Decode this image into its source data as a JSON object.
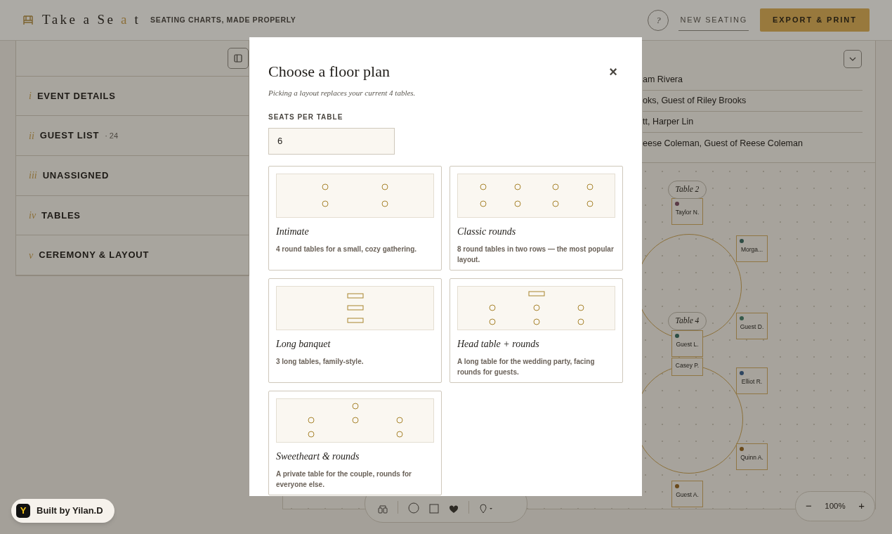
{
  "header": {
    "logo": [
      {
        "text": "Take a Se",
        "accent": false
      },
      {
        "text": "a",
        "accent": true
      },
      {
        "text": "t",
        "accent": false
      }
    ],
    "tagline": "SEATING CHARTS, MADE PROPERLY",
    "help": "?",
    "new_seating": "NEW SEATING",
    "export": "EXPORT & PRINT"
  },
  "sidebar": {
    "sections": [
      {
        "numeral": "i",
        "label": "EVENT DETAILS"
      },
      {
        "numeral": "ii",
        "label": "GUEST LIST",
        "count": "· 24"
      },
      {
        "numeral": "iii",
        "label": "UNASSIGNED"
      },
      {
        "numeral": "iv",
        "label": "TABLES"
      },
      {
        "numeral": "v",
        "label": "CEREMONY & LAYOUT"
      }
    ]
  },
  "guest_rows": [
    "am Rivera",
    "oks, Guest of Riley Brooks",
    "tt, Harper Lin",
    "eese Coleman, Guest of Reese Coleman"
  ],
  "canvas": {
    "tables": [
      {
        "label": "Table 2"
      },
      {
        "label": "Table 4"
      }
    ],
    "seats": [
      {
        "name": "Taylor N.",
        "color": "#5a3a46"
      },
      {
        "name": "Morga...",
        "color": "#2f4c44"
      },
      {
        "name": "Guest D.",
        "color": "#365a4a"
      },
      {
        "name": "Guest L.",
        "color": "#2c4e44"
      },
      {
        "name": "Casey P."
      },
      {
        "name": "Elliot R.",
        "color": "#2e4660"
      },
      {
        "name": "Quinn A.",
        "color": "#6a4a1c"
      },
      {
        "name": "Guest A.",
        "color": "#6a4a1c"
      }
    ],
    "zoom": {
      "minus": "−",
      "value": "100%",
      "plus": "+"
    }
  },
  "modal": {
    "title": "Choose a floor plan",
    "close": "×",
    "subtitle": "Picking a layout replaces your current 4 tables.",
    "seats_label": "SEATS PER TABLE",
    "seats_value": "6",
    "layouts": [
      {
        "kind": "intimate",
        "title": "Intimate",
        "description": "4 round tables for a small, cozy gathering."
      },
      {
        "kind": "classic",
        "title": "Classic rounds",
        "description": "8 round tables in two rows — the most popular layout."
      },
      {
        "kind": "banquet",
        "title": "Long banquet",
        "description": "3 long tables, family-style."
      },
      {
        "kind": "head",
        "title": "Head table + rounds",
        "description": "A long table for the wedding party, facing rounds for guests."
      },
      {
        "kind": "sweetheart",
        "title": "Sweetheart & rounds",
        "description": "A private table for the couple, rounds for everyone else."
      }
    ]
  },
  "badge": {
    "logo": "Y",
    "text": "Built by Yilan.D"
  }
}
